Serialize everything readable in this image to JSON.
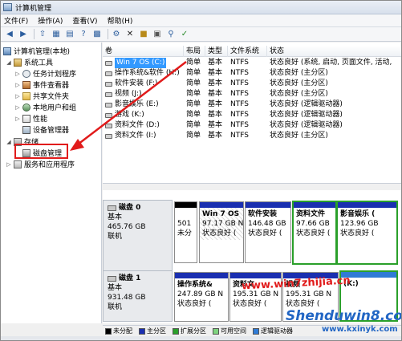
{
  "window": {
    "title": "计算机管理"
  },
  "menu": [
    "文件(F)",
    "操作(A)",
    "查看(V)",
    "帮助(H)"
  ],
  "toolbar": {
    "icons": [
      "back-icon",
      "forward-icon",
      "up-icon",
      "show-tree-icon",
      "properties-icon",
      "help-icon",
      "refresh-icon",
      "delete-icon",
      "folder-icon",
      "disk-icon",
      "search-icon",
      "settings-icon"
    ]
  },
  "tree": {
    "root": "计算机管理(本地)",
    "system_tools": "系统工具",
    "task_scheduler": "任务计划程序",
    "event_viewer": "事件查看器",
    "shared_folders": "共享文件夹",
    "local_users": "本地用户和组",
    "performance": "性能",
    "device_manager": "设备管理器",
    "storage": "存储",
    "disk_management": "磁盘管理",
    "services_apps": "服务和应用程序"
  },
  "volume_list": {
    "columns": [
      "卷",
      "布局",
      "类型",
      "文件系统",
      "状态"
    ],
    "rows": [
      {
        "vol": "Win 7 OS (C:)",
        "layout": "简单",
        "type": "基本",
        "fs": "NTFS",
        "status": "状态良好 (系统, 启动, 页面文件, 活动,"
      },
      {
        "vol": "操作系统&软件 (H:)",
        "layout": "简单",
        "type": "基本",
        "fs": "NTFS",
        "status": "状态良好 (主分区)"
      },
      {
        "vol": "软件安装 (F:)",
        "layout": "简单",
        "type": "基本",
        "fs": "NTFS",
        "status": "状态良好 (主分区)"
      },
      {
        "vol": "视频 (J:)",
        "layout": "简单",
        "type": "基本",
        "fs": "NTFS",
        "status": "状态良好 (主分区)"
      },
      {
        "vol": "影音娱乐 (E:)",
        "layout": "简单",
        "type": "基本",
        "fs": "NTFS",
        "status": "状态良好 (逻辑驱动器)"
      },
      {
        "vol": "游戏 (K:)",
        "layout": "简单",
        "type": "基本",
        "fs": "NTFS",
        "status": "状态良好 (逻辑驱动器)"
      },
      {
        "vol": "资料文件 (D:)",
        "layout": "简单",
        "type": "基本",
        "fs": "NTFS",
        "status": "状态良好 (逻辑驱动器)"
      },
      {
        "vol": "资料文件 (I:)",
        "layout": "简单",
        "type": "基本",
        "fs": "NTFS",
        "status": "状态良好 (主分区)"
      }
    ]
  },
  "disks": [
    {
      "name": "磁盘 0",
      "type": "基本",
      "size": "465.76 GB",
      "state": "联机",
      "partitions": [
        {
          "name": "",
          "size": "501",
          "status": "未分",
          "bar": "black"
        },
        {
          "name": "Win 7 OS",
          "size": "97.17 GB N",
          "status": "状态良好 (",
          "bar": "blue"
        },
        {
          "name": "软件安装",
          "size": "146.48 GB",
          "status": "状态良好 (",
          "bar": "blue"
        },
        {
          "name": "资料文件",
          "size": "97.66 GB",
          "status": "状态良好 (",
          "bar": "blue"
        },
        {
          "name": "影音娱乐 (",
          "size": "123.96 GB",
          "status": "状态良好 (",
          "bar": "blue"
        }
      ]
    },
    {
      "name": "磁盘 1",
      "type": "基本",
      "size": "931.48 GB",
      "state": "联机",
      "partitions": [
        {
          "name": "操作系统&",
          "size": "247.89 GB N",
          "status": "状态良好 (",
          "bar": "blue"
        },
        {
          "name": "资料文",
          "size": "195.31 GB N",
          "status": "状态良好 (",
          "bar": "blue"
        },
        {
          "name": "视频",
          "size": "195.31 GB N",
          "status": "状态良好 (",
          "bar": "blue"
        },
        {
          "name": "(K:)",
          "size": "",
          "status": "",
          "bar": "blue"
        }
      ]
    }
  ],
  "legend": [
    {
      "label": "未分配",
      "color": "#000000"
    },
    {
      "label": "主分区",
      "color": "#1a2fb0"
    },
    {
      "label": "扩展分区",
      "color": "#2aa02a"
    },
    {
      "label": "可用空间",
      "color": "#7ed37e"
    },
    {
      "label": "逻辑驱动器",
      "color": "#2f7bd6"
    }
  ],
  "watermarks": {
    "line1": "www.win7zhijia.cn",
    "line2": "Shenduwin8.com",
    "line3": "www.kxinyk.com"
  },
  "colors": {
    "highlight": "#e11b1b",
    "selection": "#3399ff",
    "primary": "#1a2fb0",
    "extended": "#2aa02a"
  }
}
